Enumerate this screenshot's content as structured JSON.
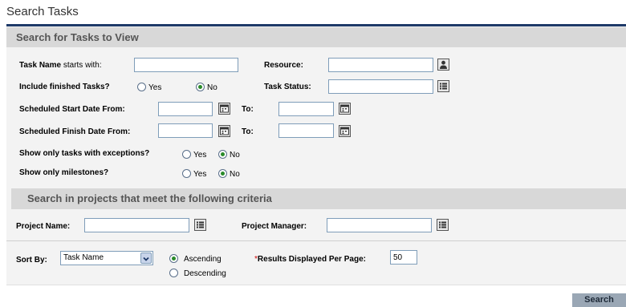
{
  "page": {
    "title": "Search Tasks"
  },
  "sections": {
    "tasks": "Search for Tasks to View",
    "projects": "Search in projects that meet the following criteria"
  },
  "fields": {
    "task_name": {
      "label_bold": "Task Name",
      "label_rest": " starts with:",
      "value": ""
    },
    "resource": {
      "label": "Resource:",
      "value": ""
    },
    "include_finished": {
      "label": "Include finished Tasks?",
      "yes": "Yes",
      "no": "No",
      "selected": "No"
    },
    "task_status": {
      "label": "Task Status:",
      "value": ""
    },
    "sched_start": {
      "label": "Scheduled Start Date From:",
      "to": "To:",
      "from_value": "",
      "to_value": ""
    },
    "sched_finish": {
      "label": "Scheduled Finish Date From:",
      "to": "To:",
      "from_value": "",
      "to_value": ""
    },
    "exceptions": {
      "label": "Show only tasks with exceptions?",
      "yes": "Yes",
      "no": "No",
      "selected": "No"
    },
    "milestones": {
      "label": "Show only milestones?",
      "yes": "Yes",
      "no": "No",
      "selected": "No"
    },
    "project_name": {
      "label": "Project Name:",
      "value": ""
    },
    "project_manager": {
      "label": "Project Manager:",
      "value": ""
    },
    "sort_by": {
      "label": "Sort By:",
      "value": "Task Name",
      "ascending": "Ascending",
      "descending": "Descending",
      "selected": "Ascending"
    },
    "results_per_page": {
      "required_mark": "*",
      "label": "Results Displayed Per Page:",
      "value": "50"
    }
  },
  "buttons": {
    "search": "Search"
  },
  "icons": {
    "resource": "person-lookup-icon",
    "list": "list-lookup-icon",
    "calendar": "calendar-icon",
    "dropdown": "chevron-down-icon"
  }
}
